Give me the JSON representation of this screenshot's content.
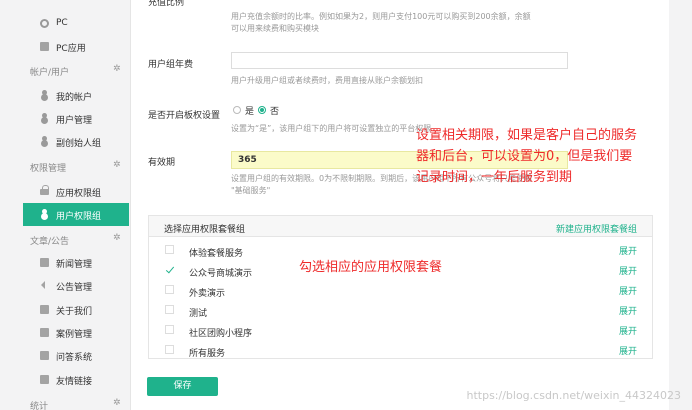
{
  "sidebar": {
    "items": [
      {
        "label": "PC",
        "icon": "circle-icon"
      },
      {
        "label": "PC应用",
        "icon": "doc-icon"
      }
    ],
    "sections": [
      {
        "title": "帐户/用户",
        "items": [
          {
            "label": "我的帐户"
          },
          {
            "label": "用户管理"
          },
          {
            "label": "副创始人组"
          }
        ]
      },
      {
        "title": "权限管理",
        "items": [
          {
            "label": "应用权限组"
          },
          {
            "label": "用户权限组",
            "active": true
          }
        ]
      },
      {
        "title": "文章/公告",
        "items": [
          {
            "label": "新闻管理"
          },
          {
            "label": "公告管理"
          },
          {
            "label": "关于我们"
          },
          {
            "label": "案例管理"
          },
          {
            "label": "问答系统"
          },
          {
            "label": "友情链接"
          }
        ]
      },
      {
        "title": "统计",
        "items": []
      }
    ]
  },
  "form": {
    "recharge": {
      "label": "充值比例",
      "hint_line1": "用户充值余额时的比率。例如如果为2，则用户支付100元可以购买到200余额，余额",
      "hint_line2": "可以用来续费和购买模块"
    },
    "annual_fee": {
      "label": "用户组年费",
      "hint": "用户升级用户组或者续费时，费用直接从账户余额划扣"
    },
    "separate_permission": {
      "label": "是否开启板权设置",
      "yes": "是",
      "no": "否",
      "hint": "设置为“是”，该用户组下的用户将可设置独立的平台权限"
    },
    "validity": {
      "label": "有效期",
      "value": "365",
      "hint_line1": "设置用户组的有效期限。0为不限制期限。到期后，该用户组下所有公众号将只能使用",
      "hint_line2": "\"基础服务\""
    }
  },
  "packages": {
    "header": "选择应用权限套餐组",
    "new_link": "新建应用权限套餐组",
    "expand_label": "展开",
    "rows": [
      {
        "name": "体验套餐服务",
        "checked": false
      },
      {
        "name": "公众号商城演示",
        "checked": true
      },
      {
        "name": "外卖演示",
        "checked": false
      },
      {
        "name": "测试",
        "checked": false
      },
      {
        "name": "社区团购小程序",
        "checked": false
      },
      {
        "name": "所有服务",
        "checked": false
      }
    ]
  },
  "save_label": "保存",
  "annotations": {
    "validity_line1": "设置相关期限，如果是客户自己的服务",
    "validity_line2": "器和后台，可以设置为0，但是我们要",
    "validity_line3": "记录时间，一年后服务到期",
    "packages_note": "勾选相应的应用权限套餐"
  },
  "watermark": "https://blog.csdn.net/weixin_44324023",
  "colors": {
    "accent": "#1fb28c",
    "annotation": "#ee2a2a",
    "highlight": "#fbfbc9"
  }
}
